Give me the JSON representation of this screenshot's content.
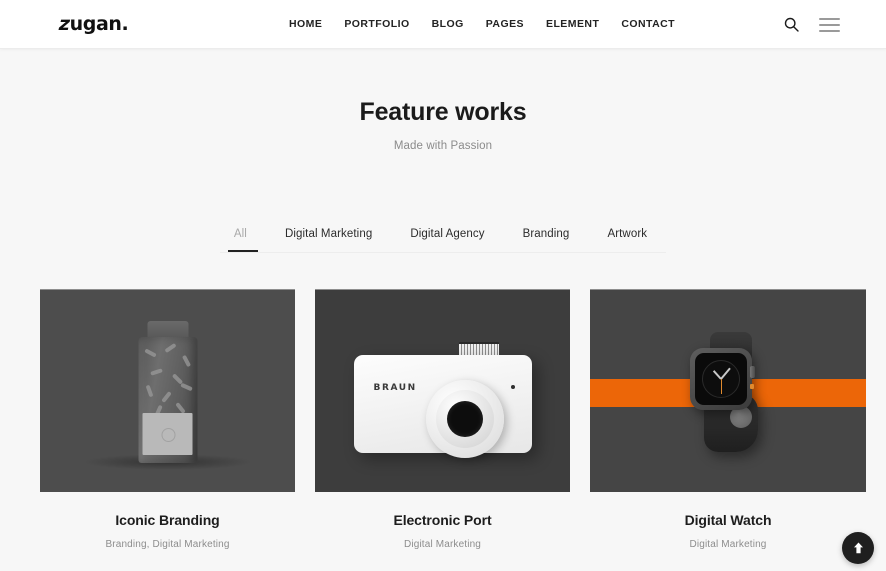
{
  "header": {
    "brand": {
      "z": "z",
      "rest": "ugan."
    },
    "nav": [
      {
        "label": "HOME"
      },
      {
        "label": "PORTFOLIO"
      },
      {
        "label": "BLOG"
      },
      {
        "label": "PAGES"
      },
      {
        "label": "ELEMENT"
      },
      {
        "label": "CONTACT"
      }
    ],
    "tools": {
      "search_icon": "search-icon",
      "menu_icon": "hamburger-menu-icon"
    }
  },
  "section": {
    "title": "Feature works",
    "subtitle": "Made with Passion"
  },
  "filters": [
    {
      "label": "All",
      "active": true
    },
    {
      "label": "Digital Marketing",
      "active": false
    },
    {
      "label": "Digital Agency",
      "active": false
    },
    {
      "label": "Branding",
      "active": false
    },
    {
      "label": "Artwork",
      "active": false
    }
  ],
  "portfolio": [
    {
      "title": "Iconic Branding",
      "categories": "Branding, Digital Marketing",
      "image_alt": "grey bottle jar product shot"
    },
    {
      "title": "Electronic Port",
      "categories": "Digital Marketing",
      "image_alt": "white BRAUN compact camera",
      "camera_brand": "BRAUN"
    },
    {
      "title": "Digital Watch",
      "categories": "Digital Marketing",
      "image_alt": "dark smartwatch with orange band"
    }
  ],
  "scroll_top": {
    "icon": "arrow-up-icon",
    "label": "Back to top"
  },
  "colors": {
    "page_bg": "#f7f7f7",
    "header_bg": "#ffffff",
    "accent_orange": "#ec6608",
    "text_dark": "#1d1d1d",
    "text_muted": "#8d8d8d",
    "card_bg_1": "#4d4d4d",
    "card_bg_2": "#3d3d3d",
    "card_bg_3": "#454545"
  }
}
